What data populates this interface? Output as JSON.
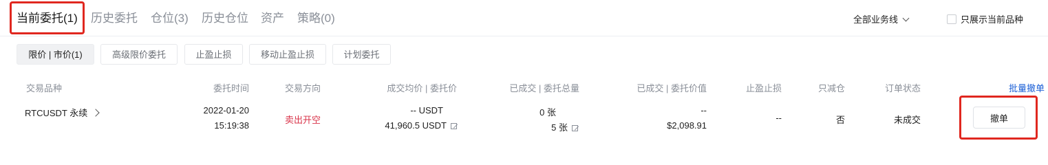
{
  "main_tabs": [
    {
      "label": "当前委托(1)"
    },
    {
      "label": "历史委托"
    },
    {
      "label": "仓位(3)"
    },
    {
      "label": "历史仓位"
    },
    {
      "label": "资产"
    },
    {
      "label": "策略(0)"
    }
  ],
  "filters": {
    "business_line": "全部业务线",
    "only_current_label": "只展示当前品种",
    "only_current_checked": false
  },
  "sub_tabs": [
    {
      "label": "限价 | 市价(1)"
    },
    {
      "label": "高级限价委托"
    },
    {
      "label": "止盈止损"
    },
    {
      "label": "移动止盈止损"
    },
    {
      "label": "计划委托"
    }
  ],
  "table": {
    "headers": {
      "symbol": "交易品种",
      "time": "委托时间",
      "side": "交易方向",
      "price": "成交均价 | 委托价",
      "amount": "已成交 | 委托总量",
      "value": "已成交 | 委托价值",
      "tpsl": "止盈止损",
      "reduce_only": "只减仓",
      "status": "订单状态",
      "batch_cancel": "批量撤单"
    },
    "rows": [
      {
        "symbol": "RTCUSDT 永续",
        "date": "2022-01-20",
        "time": "15:19:38",
        "side": "卖出开空",
        "avg_price": "-- USDT",
        "order_price": "41,960.5 USDT",
        "filled": "0 张",
        "total": "5 张",
        "filled_value": "--",
        "order_value": "$2,098.91",
        "tpsl": "--",
        "reduce_only": "否",
        "status": "未成交",
        "cancel_label": "撤单"
      }
    ]
  }
}
